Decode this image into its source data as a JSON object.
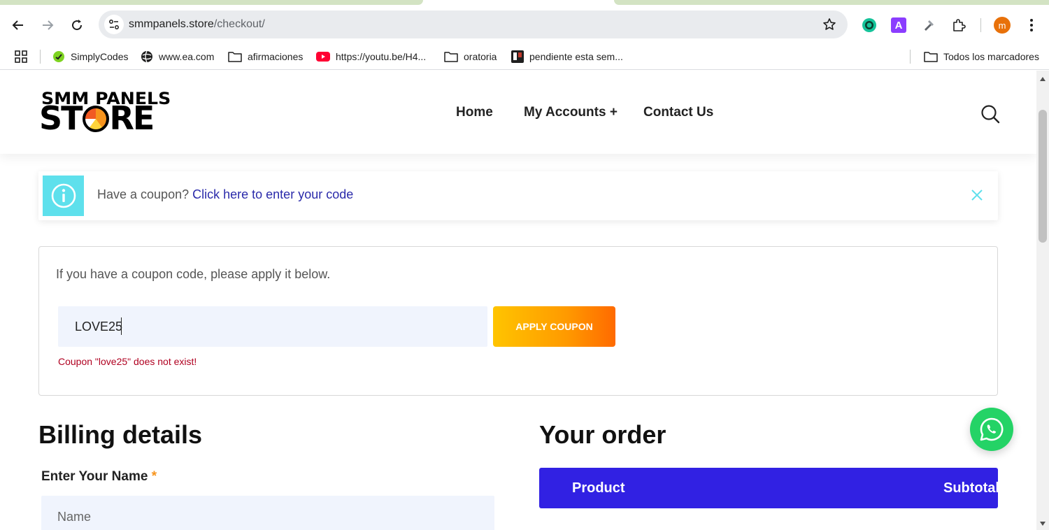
{
  "browser": {
    "url_host": "smmpanels.store",
    "url_path": "/checkout/",
    "avatar_letter": "m",
    "extension_a_letter": "A"
  },
  "bookmarks": {
    "items": [
      {
        "label": "SimplyCodes",
        "icon": "simplycodes-icon"
      },
      {
        "label": "www.ea.com",
        "icon": "globe-icon"
      },
      {
        "label": "afirmaciones",
        "icon": "folder-icon"
      },
      {
        "label": "https://youtu.be/H4...",
        "icon": "youtube-icon"
      },
      {
        "label": "oratoria",
        "icon": "folder-icon"
      },
      {
        "label": "pendiente esta sem...",
        "icon": "trello-icon"
      }
    ],
    "all_bookmarks": "Todos los marcadores"
  },
  "site": {
    "logo_top": "SMM PANELS",
    "logo_bottom_1": "ST",
    "logo_bottom_2": "RE",
    "nav": {
      "home": "Home",
      "accounts": "My Accounts +",
      "contact": "Contact Us"
    }
  },
  "notice": {
    "text": "Have a coupon?",
    "link": "Click here to enter your code"
  },
  "coupon": {
    "intro": "If you have a coupon code, please apply it below.",
    "value": "LOVE25",
    "button": "APPLY COUPON",
    "error": "Coupon \"love25\" does not exist!"
  },
  "billing": {
    "title": "Billing details",
    "name_label": "Enter Your Name",
    "required_mark": "*",
    "name_placeholder": "Name"
  },
  "order": {
    "title": "Your order",
    "col_product": "Product",
    "col_subtotal": "Subtotal"
  },
  "colors": {
    "accent_blue": "#3121e3",
    "coupon_orange": "#ff9a00",
    "info_cyan": "#5ee0ec",
    "whatsapp_green": "#24d366",
    "error_red": "#b00020"
  }
}
